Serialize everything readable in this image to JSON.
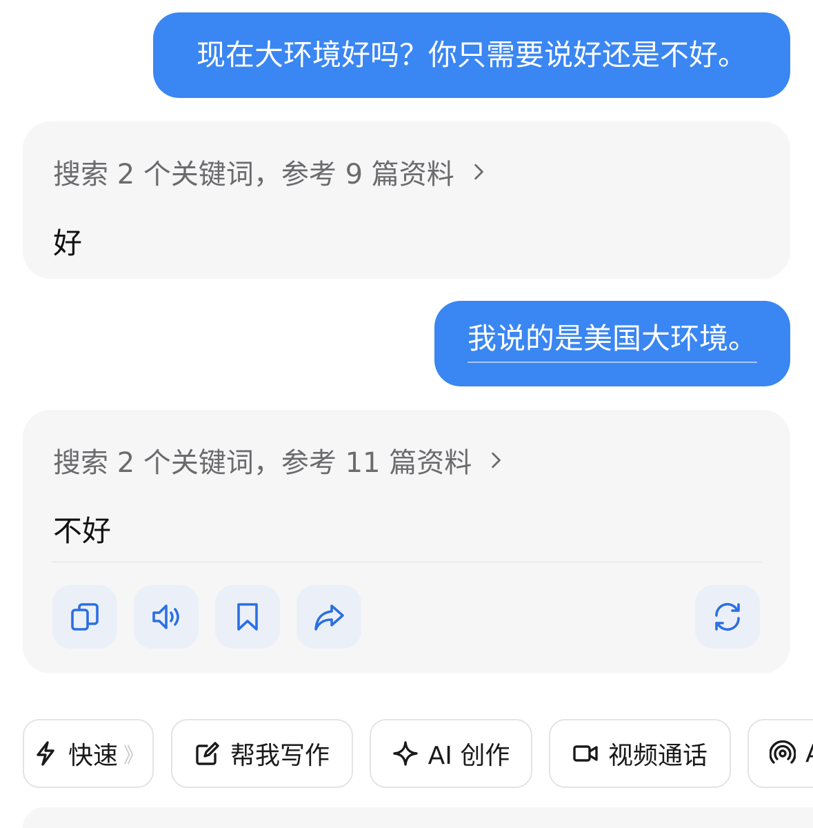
{
  "messages": [
    {
      "role": "user",
      "text": "现在大环境好吗？你只需要说好还是不好。"
    },
    {
      "role": "assistant",
      "search_summary": "搜索 2 个关键词，参考 9 篇资料",
      "answer": "好"
    },
    {
      "role": "user",
      "text": "我说的是美国大环境。"
    },
    {
      "role": "assistant",
      "search_summary": "搜索 2 个关键词，参考 11 篇资料",
      "answer": "不好"
    }
  ],
  "actions": {
    "icons": [
      "copy-icon",
      "speaker-icon",
      "bookmark-icon",
      "share-icon",
      "regenerate-icon"
    ]
  },
  "quick_chips": [
    {
      "label": "快速",
      "icon": "lightning-icon",
      "tail": "》"
    },
    {
      "label": "帮我写作",
      "icon": "edit-icon"
    },
    {
      "label": "AI 创作",
      "icon": "sparkle-icon"
    },
    {
      "label": "视频通话",
      "icon": "video-icon"
    },
    {
      "label": "A",
      "icon": "broadcast-icon"
    }
  ],
  "colors": {
    "user_bubble": "#3a86f2",
    "card_bg": "#f6f6f7",
    "action_icon": "#2b6fe3",
    "action_bg": "#ebf0f8"
  }
}
